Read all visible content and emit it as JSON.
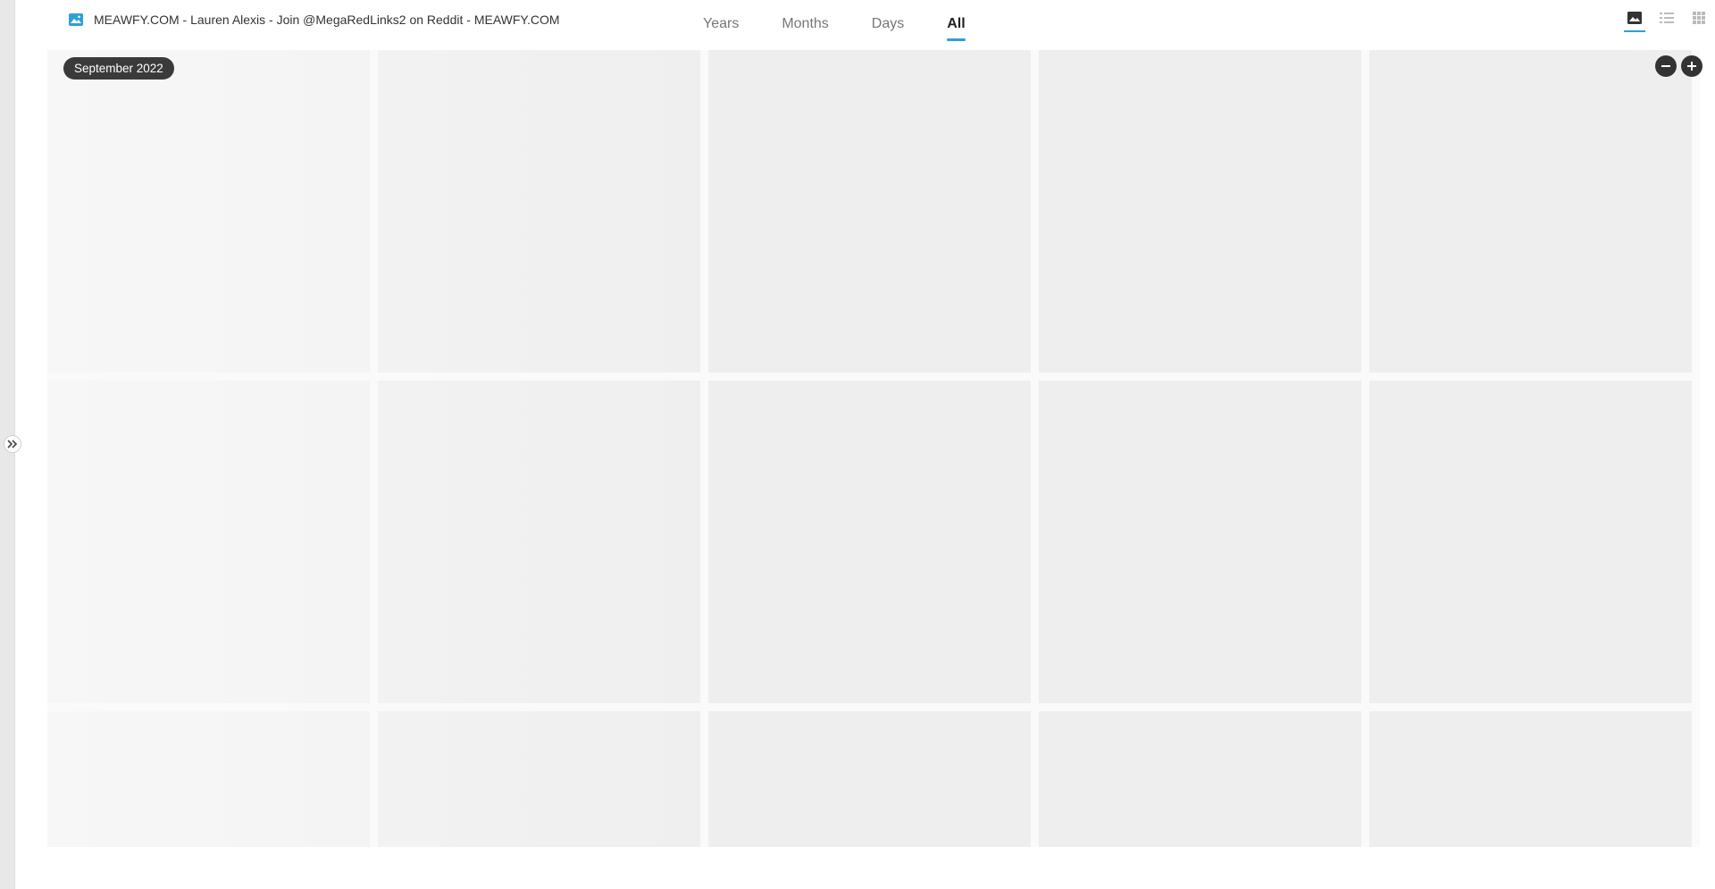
{
  "header": {
    "title": "MEAWFY.COM - Lauren Alexis - Join @MegaRedLinks2 on Reddit - MEAWFY.COM",
    "tabs": [
      {
        "label": "Years"
      },
      {
        "label": "Months"
      },
      {
        "label": "Days"
      },
      {
        "label": "All",
        "active": true
      }
    ],
    "view_modes": [
      "photo-grid-icon",
      "list-view-icon",
      "thumbnail-grid-icon"
    ],
    "active_view": "photo-grid-icon"
  },
  "gallery": {
    "date_label": "September 2022",
    "zoom_out_icon": "minus-icon",
    "zoom_in_icon": "plus-icon"
  },
  "colors": {
    "accent": "#2f9fd6",
    "badge_bg": "#3a3a3a",
    "tile": "#eeeeee"
  }
}
